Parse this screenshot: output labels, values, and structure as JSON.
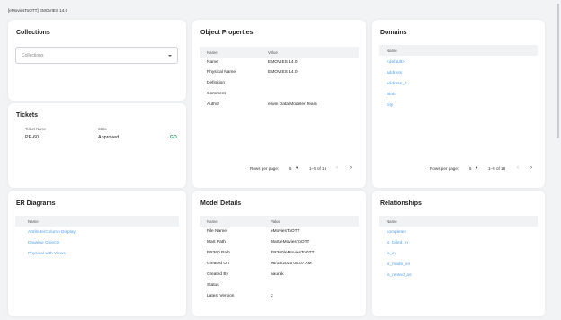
{
  "breadcrumb": "[eMoviesToOTT] EMOVIES 14.0",
  "collections": {
    "title": "Collections",
    "placeholder": "Collections"
  },
  "tickets": {
    "title": "Tickets",
    "columns": [
      "Ticket Name",
      "State"
    ],
    "row": {
      "name": "PP-60",
      "state": "Approved",
      "action": "GO"
    }
  },
  "object_properties": {
    "title": "Object Properties",
    "columns": [
      "Name",
      "Value"
    ],
    "rows": [
      {
        "name": "Name",
        "value": "EMOVIES 14.0"
      },
      {
        "name": "Physical Name",
        "value": "EMOVIES 14.0"
      },
      {
        "name": "Definition",
        "value": ""
      },
      {
        "name": "Comment",
        "value": ""
      },
      {
        "name": "Author",
        "value": "erwin Data Modeler Team"
      }
    ],
    "pager": {
      "label": "Rows per page:",
      "per_page": "5",
      "range": "1–5 of 15"
    }
  },
  "domains": {
    "title": "Domains",
    "columns": [
      "Name"
    ],
    "items": [
      "<default>",
      "address",
      "address_2",
      "Blob",
      "city"
    ],
    "pager": {
      "label": "Rows per page:",
      "per_page": "5",
      "range": "1–5 of 18"
    }
  },
  "er_diagrams": {
    "title": "ER Diagrams",
    "columns": [
      "Name"
    ],
    "items": [
      "Attribute/Column Display",
      "Drawing Objects",
      "Physical with Views"
    ]
  },
  "model_details": {
    "title": "Model Details",
    "columns": [
      "Name",
      "Value"
    ],
    "rows": [
      {
        "name": "File Name",
        "value": "eMoviesToOTT"
      },
      {
        "name": "Mart Path",
        "value": "Mart/eMoviesToOTT"
      },
      {
        "name": "ER360 Path",
        "value": "ER360/eMoviesToOTT"
      },
      {
        "name": "Created On",
        "value": "06/18/2025 09:07 AM"
      },
      {
        "name": "Created By",
        "value": "naurak"
      },
      {
        "name": "Status",
        "value": ""
      },
      {
        "name": "Latest Version",
        "value": "2"
      }
    ]
  },
  "relationships": {
    "title": "Relationships",
    "columns": [
      "Name"
    ],
    "items": [
      "completes",
      "is_billed_in",
      "is_in",
      "is_made_on",
      "is_rented_as"
    ]
  },
  "icons": {
    "dropdown": "chevron-down-icon",
    "prev": "chevron-left-icon",
    "next": "chevron-right-icon"
  },
  "colors": {
    "link": "#5aa0e8",
    "go": "#2f9e6e",
    "header_bg": "#f1f2f4",
    "page_bg": "#f2f3f5"
  }
}
